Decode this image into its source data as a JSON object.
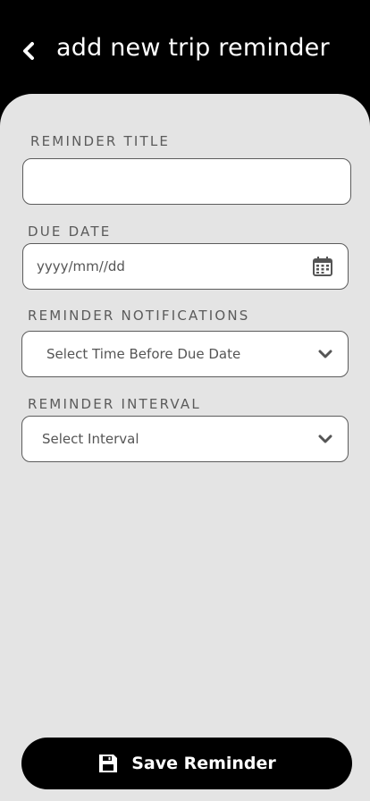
{
  "header": {
    "title": "add new trip reminder",
    "back_icon": "chevron-left-icon"
  },
  "form": {
    "reminder_title": {
      "label": "REMINDER TITLE",
      "value": ""
    },
    "due_date": {
      "label": "DUE DATE",
      "placeholder": "yyyy/mm//dd",
      "icon": "calendar-icon"
    },
    "notifications": {
      "label": "REMINDER NOTIFICATIONS",
      "selected": "Select Time Before Due Date",
      "icon": "chevron-down-icon"
    },
    "interval": {
      "label": "REMINDER INTERVAL",
      "selected": "Select Interval",
      "icon": "chevron-down-icon"
    }
  },
  "actions": {
    "save_label": "Save Reminder",
    "save_icon": "floppy-disk-icon"
  },
  "colors": {
    "header_bg": "#000000",
    "panel_bg": "#e4e4e4",
    "field_bg": "#ffffff",
    "label_text": "#5b5b5b",
    "button_bg": "#000000"
  }
}
